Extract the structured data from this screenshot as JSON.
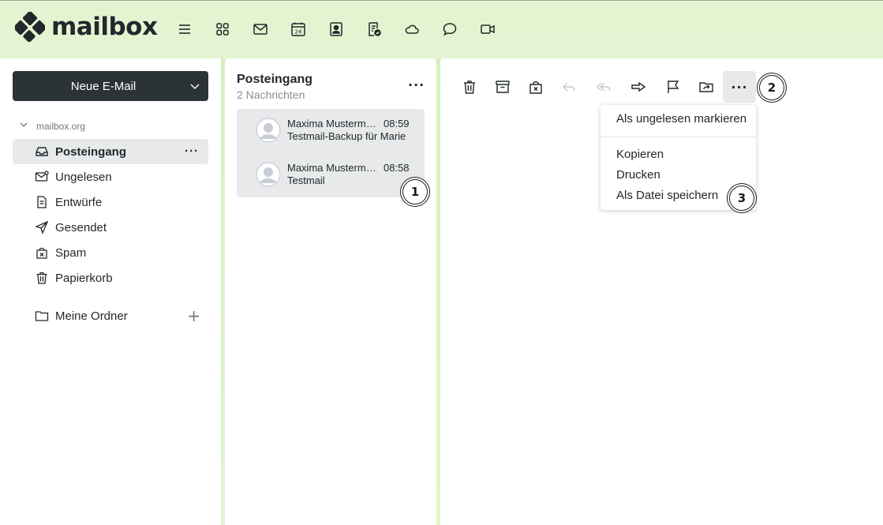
{
  "app": {
    "logo_text": "mailbox"
  },
  "header": {
    "app_icons": [
      {
        "name": "menu-icon"
      },
      {
        "name": "apps-grid-icon"
      },
      {
        "name": "mail-icon"
      },
      {
        "name": "calendar-icon",
        "label": "24"
      },
      {
        "name": "contacts-icon"
      },
      {
        "name": "tasks-icon"
      },
      {
        "name": "cloud-icon"
      },
      {
        "name": "chat-icon"
      },
      {
        "name": "video-icon"
      }
    ]
  },
  "sidebar": {
    "new_mail_label": "Neue E-Mail",
    "account": "mailbox.org",
    "folders": [
      {
        "label": "Posteingang",
        "icon": "inbox-icon",
        "active": true
      },
      {
        "label": "Ungelesen",
        "icon": "unread-mail-icon"
      },
      {
        "label": "Entwürfe",
        "icon": "draft-icon"
      },
      {
        "label": "Gesendet",
        "icon": "sent-icon"
      },
      {
        "label": "Spam",
        "icon": "spam-icon"
      },
      {
        "label": "Papierkorb",
        "icon": "trash-icon"
      }
    ],
    "my_folders_label": "Meine Ordner",
    "more_glyph": "···",
    "add_glyph": "+"
  },
  "list": {
    "title": "Posteingang",
    "count": "2 Nachrichten",
    "more_glyph": "···",
    "messages": [
      {
        "sender": "Maxima Mustermann",
        "time": "08:59",
        "subject": "Testmail-Backup für Marie"
      },
      {
        "sender": "Maxima Mustermann",
        "time": "08:58",
        "subject": "Testmail"
      }
    ]
  },
  "toolbar": {
    "icons": [
      "delete-icon",
      "archive-icon",
      "spam-icon",
      "reply-icon",
      "reply-all-icon",
      "forward-icon",
      "flag-icon",
      "move-icon",
      "more-icon"
    ],
    "more_glyph": "···",
    "disabled": [
      "reply-icon",
      "reply-all-icon"
    ]
  },
  "dropdown": {
    "items": [
      "Als ungelesen markieren",
      "Kopieren",
      "Drucken",
      "Als Datei speichern"
    ]
  },
  "badges": [
    "1",
    "2",
    "3"
  ],
  "colors": {
    "header_bg": "#e3f3cf",
    "dark_button": "#2b3336",
    "selected_bg": "#e7e9ea",
    "text": "#22282b",
    "muted": "#8a9093"
  }
}
